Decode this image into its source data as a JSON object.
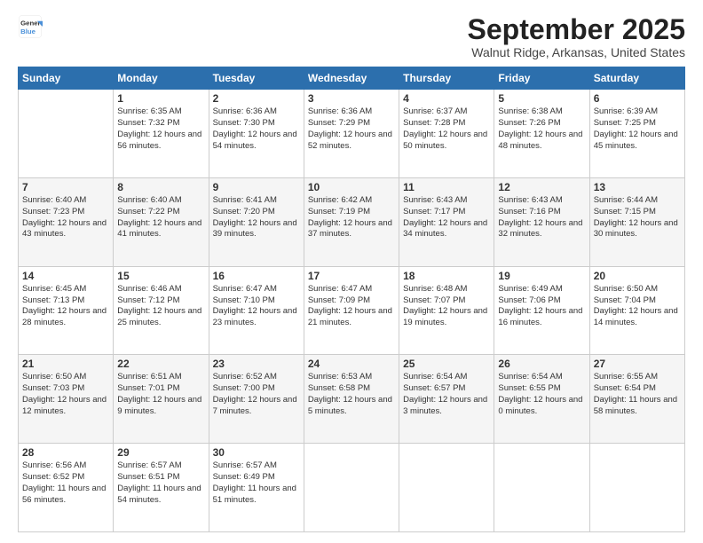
{
  "header": {
    "logo_line1": "General",
    "logo_line2": "Blue",
    "month": "September 2025",
    "location": "Walnut Ridge, Arkansas, United States"
  },
  "weekdays": [
    "Sunday",
    "Monday",
    "Tuesday",
    "Wednesday",
    "Thursday",
    "Friday",
    "Saturday"
  ],
  "weeks": [
    [
      {
        "day": "",
        "sunrise": "",
        "sunset": "",
        "daylight": ""
      },
      {
        "day": "1",
        "sunrise": "Sunrise: 6:35 AM",
        "sunset": "Sunset: 7:32 PM",
        "daylight": "Daylight: 12 hours and 56 minutes."
      },
      {
        "day": "2",
        "sunrise": "Sunrise: 6:36 AM",
        "sunset": "Sunset: 7:30 PM",
        "daylight": "Daylight: 12 hours and 54 minutes."
      },
      {
        "day": "3",
        "sunrise": "Sunrise: 6:36 AM",
        "sunset": "Sunset: 7:29 PM",
        "daylight": "Daylight: 12 hours and 52 minutes."
      },
      {
        "day": "4",
        "sunrise": "Sunrise: 6:37 AM",
        "sunset": "Sunset: 7:28 PM",
        "daylight": "Daylight: 12 hours and 50 minutes."
      },
      {
        "day": "5",
        "sunrise": "Sunrise: 6:38 AM",
        "sunset": "Sunset: 7:26 PM",
        "daylight": "Daylight: 12 hours and 48 minutes."
      },
      {
        "day": "6",
        "sunrise": "Sunrise: 6:39 AM",
        "sunset": "Sunset: 7:25 PM",
        "daylight": "Daylight: 12 hours and 45 minutes."
      }
    ],
    [
      {
        "day": "7",
        "sunrise": "Sunrise: 6:40 AM",
        "sunset": "Sunset: 7:23 PM",
        "daylight": "Daylight: 12 hours and 43 minutes."
      },
      {
        "day": "8",
        "sunrise": "Sunrise: 6:40 AM",
        "sunset": "Sunset: 7:22 PM",
        "daylight": "Daylight: 12 hours and 41 minutes."
      },
      {
        "day": "9",
        "sunrise": "Sunrise: 6:41 AM",
        "sunset": "Sunset: 7:20 PM",
        "daylight": "Daylight: 12 hours and 39 minutes."
      },
      {
        "day": "10",
        "sunrise": "Sunrise: 6:42 AM",
        "sunset": "Sunset: 7:19 PM",
        "daylight": "Daylight: 12 hours and 37 minutes."
      },
      {
        "day": "11",
        "sunrise": "Sunrise: 6:43 AM",
        "sunset": "Sunset: 7:17 PM",
        "daylight": "Daylight: 12 hours and 34 minutes."
      },
      {
        "day": "12",
        "sunrise": "Sunrise: 6:43 AM",
        "sunset": "Sunset: 7:16 PM",
        "daylight": "Daylight: 12 hours and 32 minutes."
      },
      {
        "day": "13",
        "sunrise": "Sunrise: 6:44 AM",
        "sunset": "Sunset: 7:15 PM",
        "daylight": "Daylight: 12 hours and 30 minutes."
      }
    ],
    [
      {
        "day": "14",
        "sunrise": "Sunrise: 6:45 AM",
        "sunset": "Sunset: 7:13 PM",
        "daylight": "Daylight: 12 hours and 28 minutes."
      },
      {
        "day": "15",
        "sunrise": "Sunrise: 6:46 AM",
        "sunset": "Sunset: 7:12 PM",
        "daylight": "Daylight: 12 hours and 25 minutes."
      },
      {
        "day": "16",
        "sunrise": "Sunrise: 6:47 AM",
        "sunset": "Sunset: 7:10 PM",
        "daylight": "Daylight: 12 hours and 23 minutes."
      },
      {
        "day": "17",
        "sunrise": "Sunrise: 6:47 AM",
        "sunset": "Sunset: 7:09 PM",
        "daylight": "Daylight: 12 hours and 21 minutes."
      },
      {
        "day": "18",
        "sunrise": "Sunrise: 6:48 AM",
        "sunset": "Sunset: 7:07 PM",
        "daylight": "Daylight: 12 hours and 19 minutes."
      },
      {
        "day": "19",
        "sunrise": "Sunrise: 6:49 AM",
        "sunset": "Sunset: 7:06 PM",
        "daylight": "Daylight: 12 hours and 16 minutes."
      },
      {
        "day": "20",
        "sunrise": "Sunrise: 6:50 AM",
        "sunset": "Sunset: 7:04 PM",
        "daylight": "Daylight: 12 hours and 14 minutes."
      }
    ],
    [
      {
        "day": "21",
        "sunrise": "Sunrise: 6:50 AM",
        "sunset": "Sunset: 7:03 PM",
        "daylight": "Daylight: 12 hours and 12 minutes."
      },
      {
        "day": "22",
        "sunrise": "Sunrise: 6:51 AM",
        "sunset": "Sunset: 7:01 PM",
        "daylight": "Daylight: 12 hours and 9 minutes."
      },
      {
        "day": "23",
        "sunrise": "Sunrise: 6:52 AM",
        "sunset": "Sunset: 7:00 PM",
        "daylight": "Daylight: 12 hours and 7 minutes."
      },
      {
        "day": "24",
        "sunrise": "Sunrise: 6:53 AM",
        "sunset": "Sunset: 6:58 PM",
        "daylight": "Daylight: 12 hours and 5 minutes."
      },
      {
        "day": "25",
        "sunrise": "Sunrise: 6:54 AM",
        "sunset": "Sunset: 6:57 PM",
        "daylight": "Daylight: 12 hours and 3 minutes."
      },
      {
        "day": "26",
        "sunrise": "Sunrise: 6:54 AM",
        "sunset": "Sunset: 6:55 PM",
        "daylight": "Daylight: 12 hours and 0 minutes."
      },
      {
        "day": "27",
        "sunrise": "Sunrise: 6:55 AM",
        "sunset": "Sunset: 6:54 PM",
        "daylight": "Daylight: 11 hours and 58 minutes."
      }
    ],
    [
      {
        "day": "28",
        "sunrise": "Sunrise: 6:56 AM",
        "sunset": "Sunset: 6:52 PM",
        "daylight": "Daylight: 11 hours and 56 minutes."
      },
      {
        "day": "29",
        "sunrise": "Sunrise: 6:57 AM",
        "sunset": "Sunset: 6:51 PM",
        "daylight": "Daylight: 11 hours and 54 minutes."
      },
      {
        "day": "30",
        "sunrise": "Sunrise: 6:57 AM",
        "sunset": "Sunset: 6:49 PM",
        "daylight": "Daylight: 11 hours and 51 minutes."
      },
      {
        "day": "",
        "sunrise": "",
        "sunset": "",
        "daylight": ""
      },
      {
        "day": "",
        "sunrise": "",
        "sunset": "",
        "daylight": ""
      },
      {
        "day": "",
        "sunrise": "",
        "sunset": "",
        "daylight": ""
      },
      {
        "day": "",
        "sunrise": "",
        "sunset": "",
        "daylight": ""
      }
    ]
  ]
}
